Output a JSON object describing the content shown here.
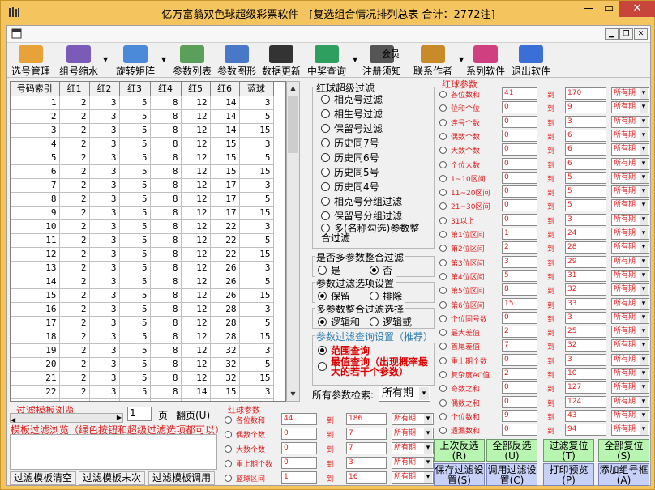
{
  "window": {
    "title": "亿万富翁双色球超级彩票软件 - [复选组合情况排列总表  合计：2772注]",
    "close": "✕",
    "maximize": "▭",
    "minimize": "—"
  },
  "toolbar": [
    {
      "label": "选号管理",
      "icon": "tt-icon",
      "color": "#e8a23a"
    },
    {
      "label": "组号缩水",
      "icon": "cube-icon",
      "color": "#7a5bb8"
    },
    {
      "label": "旋转矩阵",
      "icon": "matrix-icon",
      "color": "#4a8ad8"
    },
    {
      "label": "参数列表",
      "icon": "list-icon",
      "color": "#5aa05a"
    },
    {
      "label": "参数图形",
      "icon": "chart-icon",
      "color": "#4a78c8"
    },
    {
      "label": "数据更新",
      "icon": "pc-icon",
      "color": "#333333"
    },
    {
      "label": "中奖查询",
      "icon": "ball-icon",
      "color": "#2f9f5f"
    },
    {
      "label": "注册须知",
      "icon": "member-icon",
      "color": "#555555",
      "top": "会员"
    },
    {
      "label": "联系作者",
      "icon": "eagle-icon",
      "color": "#c98a2a"
    },
    {
      "label": "系列软件",
      "icon": "hot-icon",
      "color": "#d04080"
    },
    {
      "label": "退出软件",
      "icon": "go-icon",
      "color": "#3a6fd8"
    }
  ],
  "grid": {
    "headers": [
      "号码索引",
      "红1",
      "红2",
      "红3",
      "红4",
      "红5",
      "红6",
      "蓝球"
    ],
    "rows": [
      [
        "1",
        "2",
        "3",
        "5",
        "8",
        "12",
        "14",
        "3"
      ],
      [
        "2",
        "2",
        "3",
        "5",
        "8",
        "12",
        "14",
        "5"
      ],
      [
        "3",
        "2",
        "3",
        "5",
        "8",
        "12",
        "14",
        "15"
      ],
      [
        "4",
        "2",
        "3",
        "5",
        "8",
        "12",
        "15",
        "3"
      ],
      [
        "5",
        "2",
        "3",
        "5",
        "8",
        "12",
        "15",
        "5"
      ],
      [
        "6",
        "2",
        "3",
        "5",
        "8",
        "12",
        "15",
        "15"
      ],
      [
        "7",
        "2",
        "3",
        "5",
        "8",
        "12",
        "17",
        "3"
      ],
      [
        "8",
        "2",
        "3",
        "5",
        "8",
        "12",
        "17",
        "5"
      ],
      [
        "9",
        "2",
        "3",
        "5",
        "8",
        "12",
        "17",
        "15"
      ],
      [
        "10",
        "2",
        "3",
        "5",
        "8",
        "12",
        "22",
        "3"
      ],
      [
        "11",
        "2",
        "3",
        "5",
        "8",
        "12",
        "22",
        "5"
      ],
      [
        "12",
        "2",
        "3",
        "5",
        "8",
        "12",
        "22",
        "15"
      ],
      [
        "13",
        "2",
        "3",
        "5",
        "8",
        "12",
        "26",
        "3"
      ],
      [
        "14",
        "2",
        "3",
        "5",
        "8",
        "12",
        "26",
        "5"
      ],
      [
        "15",
        "2",
        "3",
        "5",
        "8",
        "12",
        "26",
        "15"
      ],
      [
        "16",
        "2",
        "3",
        "5",
        "8",
        "12",
        "28",
        "3"
      ],
      [
        "17",
        "2",
        "3",
        "5",
        "8",
        "12",
        "28",
        "5"
      ],
      [
        "18",
        "2",
        "3",
        "5",
        "8",
        "12",
        "28",
        "15"
      ],
      [
        "19",
        "2",
        "3",
        "5",
        "8",
        "12",
        "32",
        "3"
      ],
      [
        "20",
        "2",
        "3",
        "5",
        "8",
        "12",
        "32",
        "5"
      ],
      [
        "21",
        "2",
        "3",
        "5",
        "8",
        "12",
        "32",
        "15"
      ],
      [
        "22",
        "2",
        "3",
        "5",
        "8",
        "14",
        "15",
        "3"
      ],
      [
        "23",
        "2",
        "3",
        "5",
        "8",
        "14",
        "15",
        "5"
      ],
      [
        "24",
        "2",
        "3",
        "5",
        "8",
        "14",
        "15",
        "15"
      ],
      [
        "25",
        "2",
        "3",
        "5",
        "8",
        "14",
        "17",
        "3"
      ]
    ]
  },
  "red_filter": {
    "title": "红球超级过滤",
    "options": [
      "相克号过滤",
      "相生号过滤",
      "保留号过滤",
      "历史同7号",
      "历史同6号",
      "历史同5号",
      "历史同4号",
      "相克号分组过滤",
      "保留号分组过滤",
      "多(名称勾选)参数整合过滤"
    ]
  },
  "multi": {
    "title": "是否多参数整合过滤",
    "yes": "是",
    "no": "否"
  },
  "mode": {
    "title": "参数过滤选项设置",
    "keep": "保留",
    "exclude": "排除"
  },
  "logic": {
    "title": "多参数整合过滤选择",
    "and": "逻辑和",
    "or": "逻辑或"
  },
  "query": {
    "title": "参数过滤查询设置（推荐）",
    "range": "范围查询",
    "best": "最值查询（出现概率最大的若干个参数）"
  },
  "search": {
    "label": "所有参数检索:",
    "value": "所有期"
  },
  "params": {
    "title": "红球参数",
    "rows": [
      [
        "各位数和",
        "41",
        "170",
        "所有期"
      ],
      [
        "位和个位",
        "0",
        "9",
        "所有期"
      ],
      [
        "连号个数",
        "0",
        "3",
        "所有期"
      ],
      [
        "偶数个数",
        "0",
        "6",
        "所有期"
      ],
      [
        "大数个数",
        "0",
        "6",
        "所有期"
      ],
      [
        "个位大数",
        "0",
        "6",
        "所有期"
      ],
      [
        "1~10区间",
        "0",
        "5",
        "所有期"
      ],
      [
        "11~20区间",
        "0",
        "5",
        "所有期"
      ],
      [
        "21~30区间",
        "0",
        "5",
        "所有期"
      ],
      [
        "31以上",
        "0",
        "3",
        "所有期"
      ],
      [
        "第1位区间",
        "1",
        "24",
        "所有期"
      ],
      [
        "第2位区间",
        "2",
        "28",
        "所有期"
      ],
      [
        "第3位区间",
        "3",
        "29",
        "所有期"
      ],
      [
        "第4位区间",
        "5",
        "31",
        "所有期"
      ],
      [
        "第5位区间",
        "8",
        "32",
        "所有期"
      ],
      [
        "第6位区间",
        "15",
        "33",
        "所有期"
      ],
      [
        "个位同号数",
        "0",
        "3",
        "所有期"
      ],
      [
        "最大差值",
        "2",
        "25",
        "所有期"
      ],
      [
        "首尾差值",
        "7",
        "32",
        "所有期"
      ],
      [
        "重上期个数",
        "0",
        "3",
        "所有期"
      ],
      [
        "复杂度AC值",
        "2",
        "10",
        "所有期"
      ],
      [
        "奇数之和",
        "0",
        "127",
        "所有期"
      ],
      [
        "偶数之和",
        "0",
        "124",
        "所有期"
      ],
      [
        "个位数和",
        "9",
        "43",
        "所有期"
      ],
      [
        "遗漏数和",
        "0",
        "94",
        "所有期"
      ]
    ],
    "to": "到"
  },
  "sub": {
    "title": "红球参数",
    "rows": [
      [
        "各位数和",
        "44",
        "186",
        "所有期"
      ],
      [
        "偶数个数",
        "0",
        "7",
        "所有期"
      ],
      [
        "大数个数",
        "0",
        "7",
        "所有期"
      ],
      [
        "重上期个数",
        "0",
        "3",
        "所有期"
      ],
      [
        "蓝球区间",
        "1",
        "16",
        "所有期"
      ]
    ]
  },
  "buttons": {
    "prev": "上次反选(R)",
    "all": "全部反选(U)",
    "reset": "过滤复位(T)",
    "allreset": "全部复位(S)",
    "save": "保存过滤设置(S)",
    "load": "调用过滤设置(C)",
    "print": "打印预览(P)",
    "addgroup": "添加组号框(A)"
  },
  "template": {
    "browse": "过滤模板浏览",
    "desc": "模板过滤浏览（绿色按钮和超级过滤选项都可以）",
    "page": "1",
    "page_lbl": "页",
    "flip": "翻页(U)",
    "clear": "过滤模板清空",
    "last": "过滤模板末次",
    "call": "过滤模板调用"
  }
}
